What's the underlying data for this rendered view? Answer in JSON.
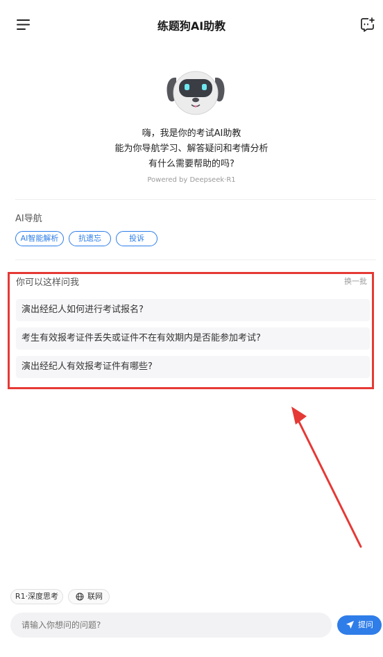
{
  "header": {
    "title": "练题狗AI助教",
    "menu_icon": "hamburger-menu-icon",
    "new_chat_icon": "new-chat-icon"
  },
  "intro": {
    "line1": "嗨，我是你的考试AI助教",
    "line2": "能为你导航学习、解答疑问和考情分析",
    "line3": "有什么需要帮助的吗?",
    "powered": "Powered by Deepseek·R1"
  },
  "ai_nav": {
    "title": "AI导航",
    "chips": [
      "AI智能解析",
      "抗遗忘",
      "投诉"
    ]
  },
  "suggestions": {
    "title": "你可以这样问我",
    "refresh": "换一批",
    "items": [
      "演出经纪人如何进行考试报名?",
      "考生有效报考证件丢失或证件不在有效期内是否能参加考试?",
      "演出经纪人有效报考证件有哪些?"
    ]
  },
  "composer": {
    "mode_deep": "R1·深度思考",
    "mode_web": "联网",
    "placeholder": "请输入你想问的问题?",
    "ask": "提问"
  },
  "colors": {
    "accent": "#2f7de8",
    "highlight": "#e53935"
  }
}
